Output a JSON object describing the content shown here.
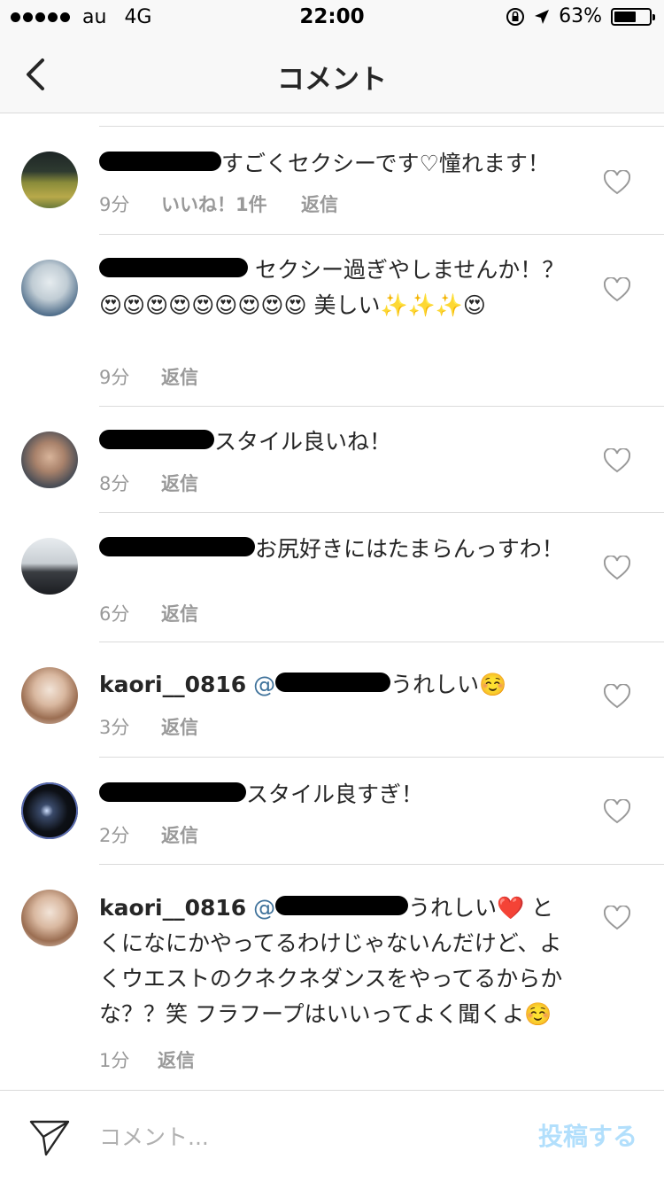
{
  "status_bar": {
    "carrier": "au",
    "network": "4G",
    "time": "22:00",
    "battery": "63%",
    "battery_level": 0.63
  },
  "nav": {
    "title": "コメント",
    "back_icon": "chevron-left-icon"
  },
  "comments": [
    {
      "username_visible": "",
      "text": "すごくセクシーです♡憧れます！",
      "time": "9分",
      "likes": "いいね！1件",
      "reply": "返信",
      "avatar_color": "#5a6a3a"
    },
    {
      "username_visible": "",
      "text": "セクシー過ぎやしませんか！？😍😍😍😍😍😍😍😍😍 美しい✨✨✨😍",
      "time": "9分",
      "reply": "返信",
      "avatar_color": "#9aa6b0"
    },
    {
      "username_visible": "",
      "text": "スタイル良いね！",
      "time": "8分",
      "reply": "返信",
      "avatar_color": "#7a6a5c"
    },
    {
      "username_visible": "",
      "text": "お尻好きにはたまらんっすわ！",
      "time": "6分",
      "reply": "返信",
      "avatar_color": "#55585e"
    },
    {
      "username_visible": "kaori__0816",
      "mention_prefix": "@",
      "text": "うれしい☺️",
      "time": "3分",
      "reply": "返信",
      "avatar_color": "#c9a68a"
    },
    {
      "username_visible": "",
      "text": "スタイル良すぎ！",
      "time": "2分",
      "reply": "返信",
      "avatar_color": "#101418"
    },
    {
      "username_visible": "kaori__0816",
      "mention_prefix": "@",
      "text": "うれしい❤️ とくになにかやってるわけじゃないんだけど、よくウエストのクネクネダンスをやってるからかな？？笑 フラフープはいいってよく聞くよ☺️",
      "time": "1分",
      "reply": "返信",
      "avatar_color": "#c9a68a"
    }
  ],
  "input": {
    "placeholder": "コメント...",
    "post_label": "投稿する"
  },
  "colors": {
    "mention": "#3f729b",
    "meta": "#999999",
    "post_disabled": "#b2dffc",
    "divider": "#dbdbdb"
  }
}
